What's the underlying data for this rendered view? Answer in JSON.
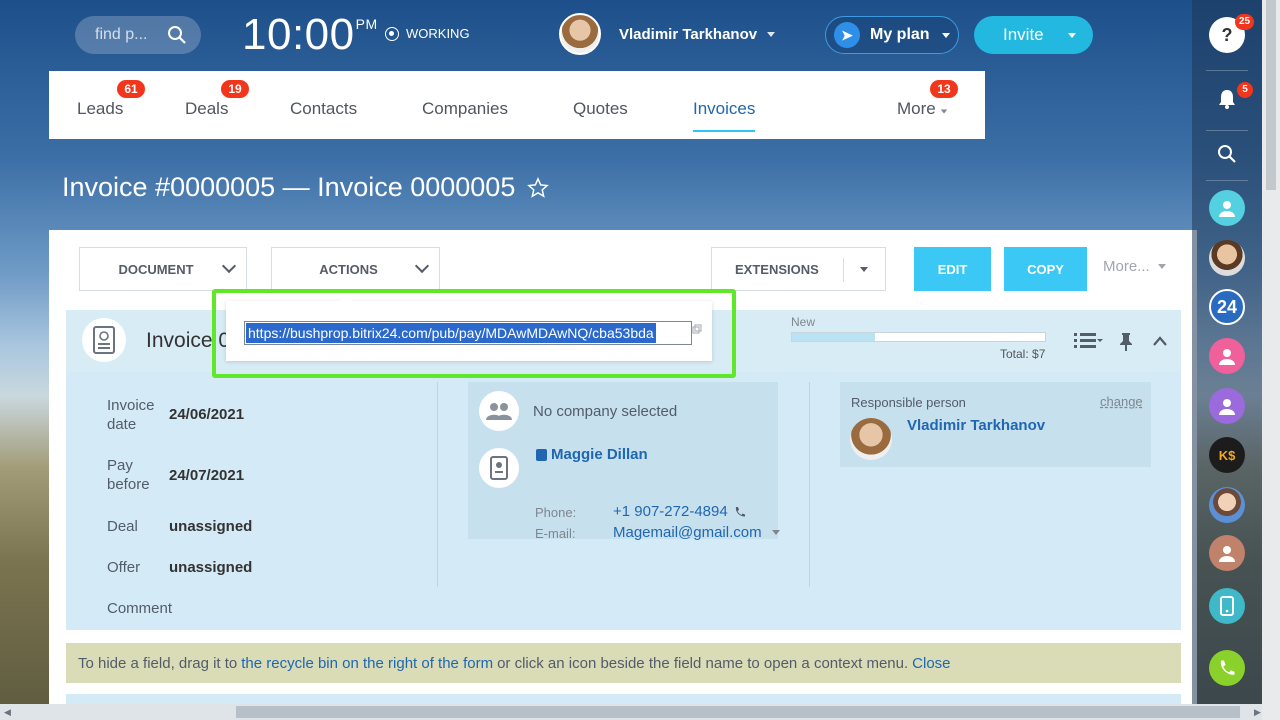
{
  "topbar": {
    "search_placeholder": "find p...",
    "clock_time": "10:00",
    "clock_ampm": "PM",
    "status": "WORKING",
    "user_name": "Vladimir Tarkhanov",
    "plan_label": "My plan",
    "invite_label": "Invite"
  },
  "nav": {
    "items": [
      {
        "label": "Leads",
        "badge": "61"
      },
      {
        "label": "Deals",
        "badge": "19"
      },
      {
        "label": "Contacts"
      },
      {
        "label": "Companies"
      },
      {
        "label": "Quotes"
      },
      {
        "label": "Invoices",
        "active": true
      },
      {
        "label": "More",
        "badge": "13"
      }
    ]
  },
  "page": {
    "title": "Invoice #0000005 — Invoice 0000005"
  },
  "toolbar": {
    "document": "DOCUMENT",
    "actions": "ACTIONS",
    "extensions": "EXTENSIONS",
    "edit": "EDIT",
    "copy": "COPY",
    "more": "More..."
  },
  "invoice": {
    "header_title": "Invoice 0",
    "stage_label": "New",
    "stage_progress": 0.33,
    "total": "Total: $7",
    "fields": {
      "invoice_date_label": "Invoice date",
      "invoice_date": "24/06/2021",
      "pay_before_label": "Pay before",
      "pay_before": "24/07/2021",
      "deal_label": "Deal",
      "deal": "unassigned",
      "offer_label": "Offer",
      "offer": "unassigned",
      "comment_label": "Comment"
    },
    "company": "No company selected",
    "contact": {
      "name": "Maggie Dillan",
      "phone_label": "Phone:",
      "phone": "+1 907-272-4894",
      "email_label": "E-mail:",
      "email": "Magemail@gmail.com"
    },
    "responsible": {
      "label": "Responsible person",
      "change": "change",
      "name": "Vladimir Tarkhanov"
    }
  },
  "hint": {
    "before": "To hide a field, drag it to ",
    "link": "the recycle bin on the right of the form",
    "after": " or click an icon beside the field name to open a context menu. ",
    "close": "Close"
  },
  "popup": {
    "url": "https://bushprop.bitrix24.com/pub/pay/MDAwMDAwNQ/cba53bda"
  },
  "rail": {
    "help_badge": "25",
    "bell_badge": "5",
    "bitrix_label": "24",
    "ks_label": "K$"
  },
  "colors": {
    "accent": "#3bc8f5",
    "badge": "#f1361b",
    "highlight_border": "#5fe82a",
    "link": "#2067b0"
  }
}
